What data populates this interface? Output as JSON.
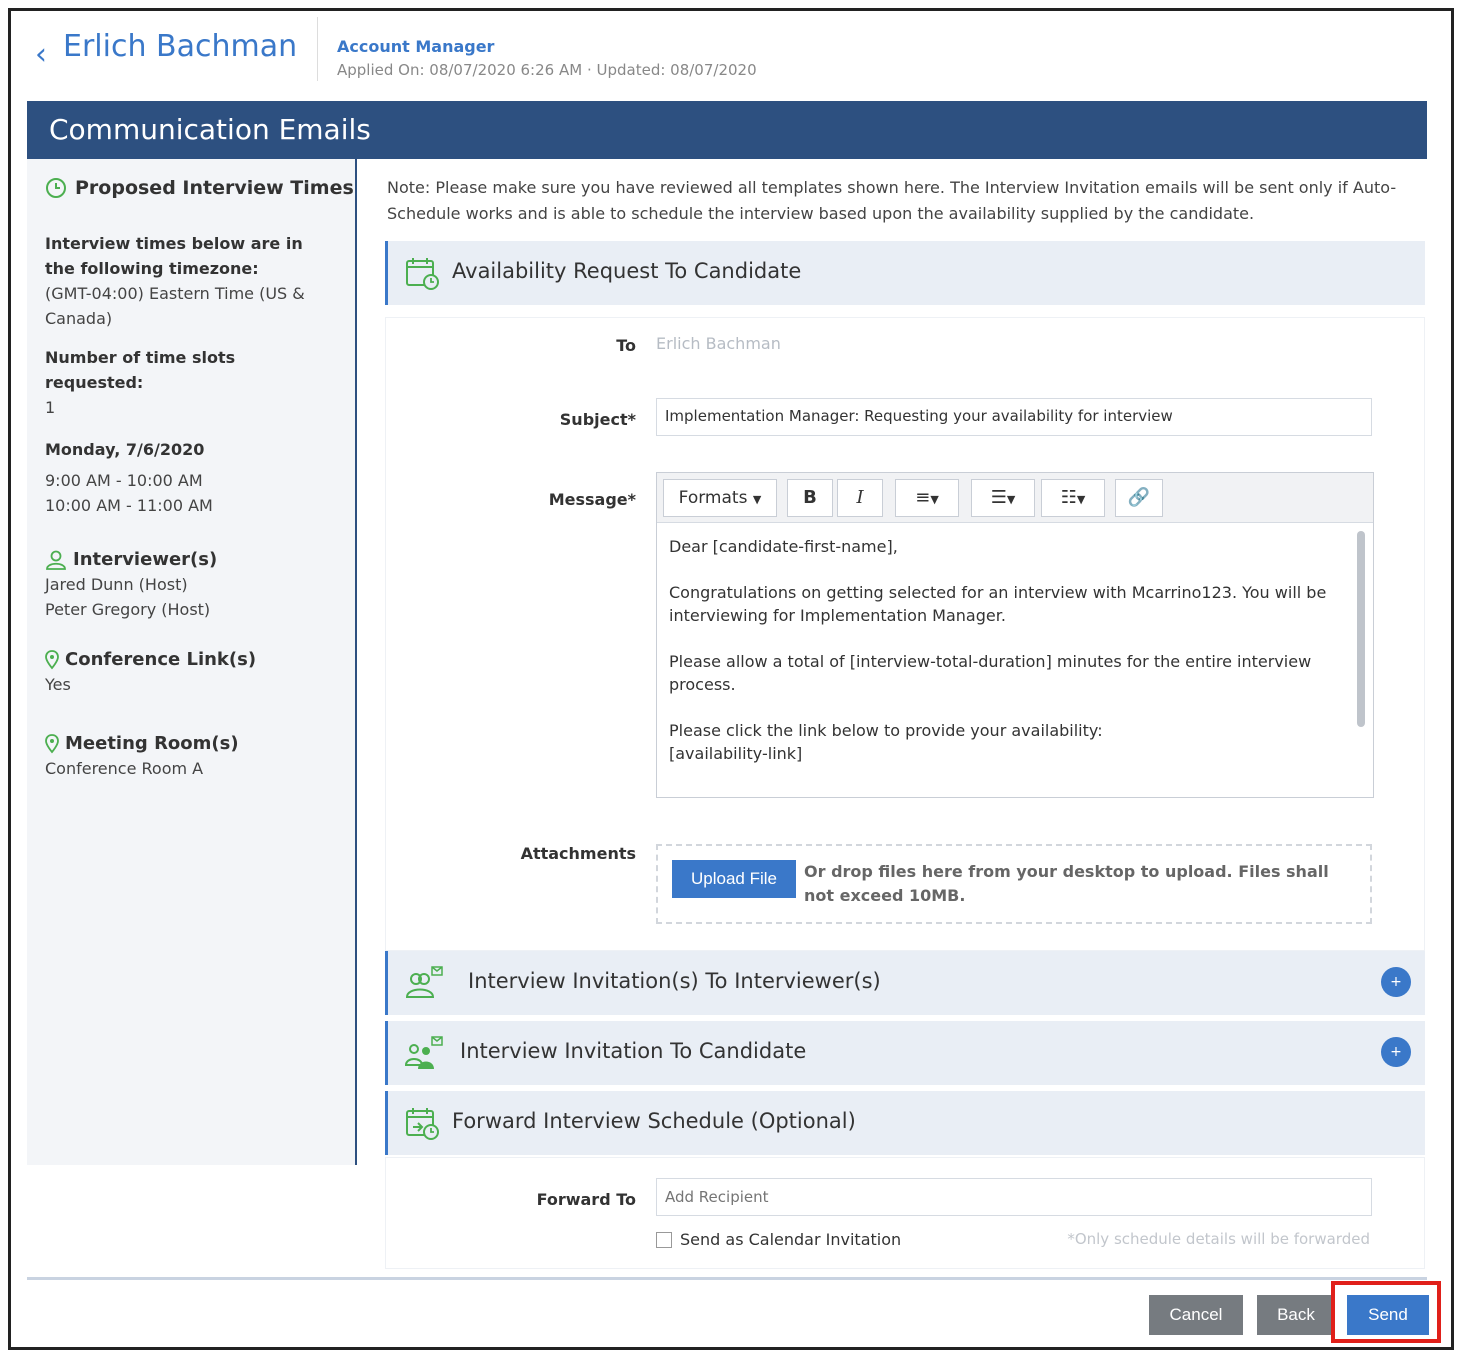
{
  "header": {
    "candidate_name": "Erlich Bachman",
    "job_title": "Account Manager",
    "applied": "Applied On: 08/07/2020 6:26 AM",
    "updated": "Updated: 08/07/2020"
  },
  "banner": {
    "title": "Communication Emails"
  },
  "sidebar": {
    "title": "Proposed Interview Times",
    "timezone_label": "Interview times below are in the following timezone:",
    "timezone_value": "(GMT-04:00) Eastern Time (US & Canada)",
    "slots_label": "Number of time slots requested:",
    "slots_value": "1",
    "date": "Monday, 7/6/2020",
    "times": [
      "9:00 AM - 10:00 AM",
      "10:00 AM - 11:00 AM"
    ],
    "interviewers_label": "Interviewer(s)",
    "interviewers": [
      "Jared Dunn (Host)",
      "Peter Gregory (Host)"
    ],
    "conference_label": "Conference Link(s)",
    "conference_value": "Yes",
    "room_label": "Meeting Room(s)",
    "room_value": "Conference Room A"
  },
  "main": {
    "note": "Note: Please make sure you have reviewed all templates shown here. The Interview Invitation emails will be sent only if Auto-Schedule works and is able to schedule the interview based upon the availability supplied by the candidate.",
    "sections": {
      "availability": "Availability Request To Candidate",
      "interviewers": "Interview Invitation(s) To Interviewer(s)",
      "candidate": "Interview Invitation To Candidate",
      "forward": "Forward Interview Schedule (Optional)"
    },
    "form": {
      "to_label": "To",
      "to_value": "Erlich Bachman",
      "subject_label": "Subject",
      "subject_value": "Implementation Manager: Requesting your availability for interview",
      "message_label": "Message",
      "required_mark": "*",
      "toolbar": {
        "formats": "Formats"
      },
      "message_lines": [
        "Dear [candidate-first-name],",
        "Congratulations on getting selected for an interview with Mcarrino123. You will be interviewing for Implementation Manager.",
        "Please allow a total of [interview-total-duration] minutes for the entire interview process.",
        "Please click the link below to provide your availability:\n[availability-link]"
      ],
      "attachments_label": "Attachments",
      "upload_label": "Upload File",
      "drop_text": "Or drop files here from your desktop to upload. Files shall not exceed 10MB."
    },
    "forward": {
      "label": "Forward To",
      "placeholder": "Add Recipient",
      "calendar_label": "Send as Calendar Invitation",
      "note": "*Only schedule details will be forwarded"
    }
  },
  "footer": {
    "cancel": "Cancel",
    "back": "Back",
    "send": "Send"
  },
  "colors": {
    "accent": "#3a78c9",
    "banner": "#2d5080",
    "highlight": "#e0201a",
    "icon_green": "#4caf50"
  }
}
